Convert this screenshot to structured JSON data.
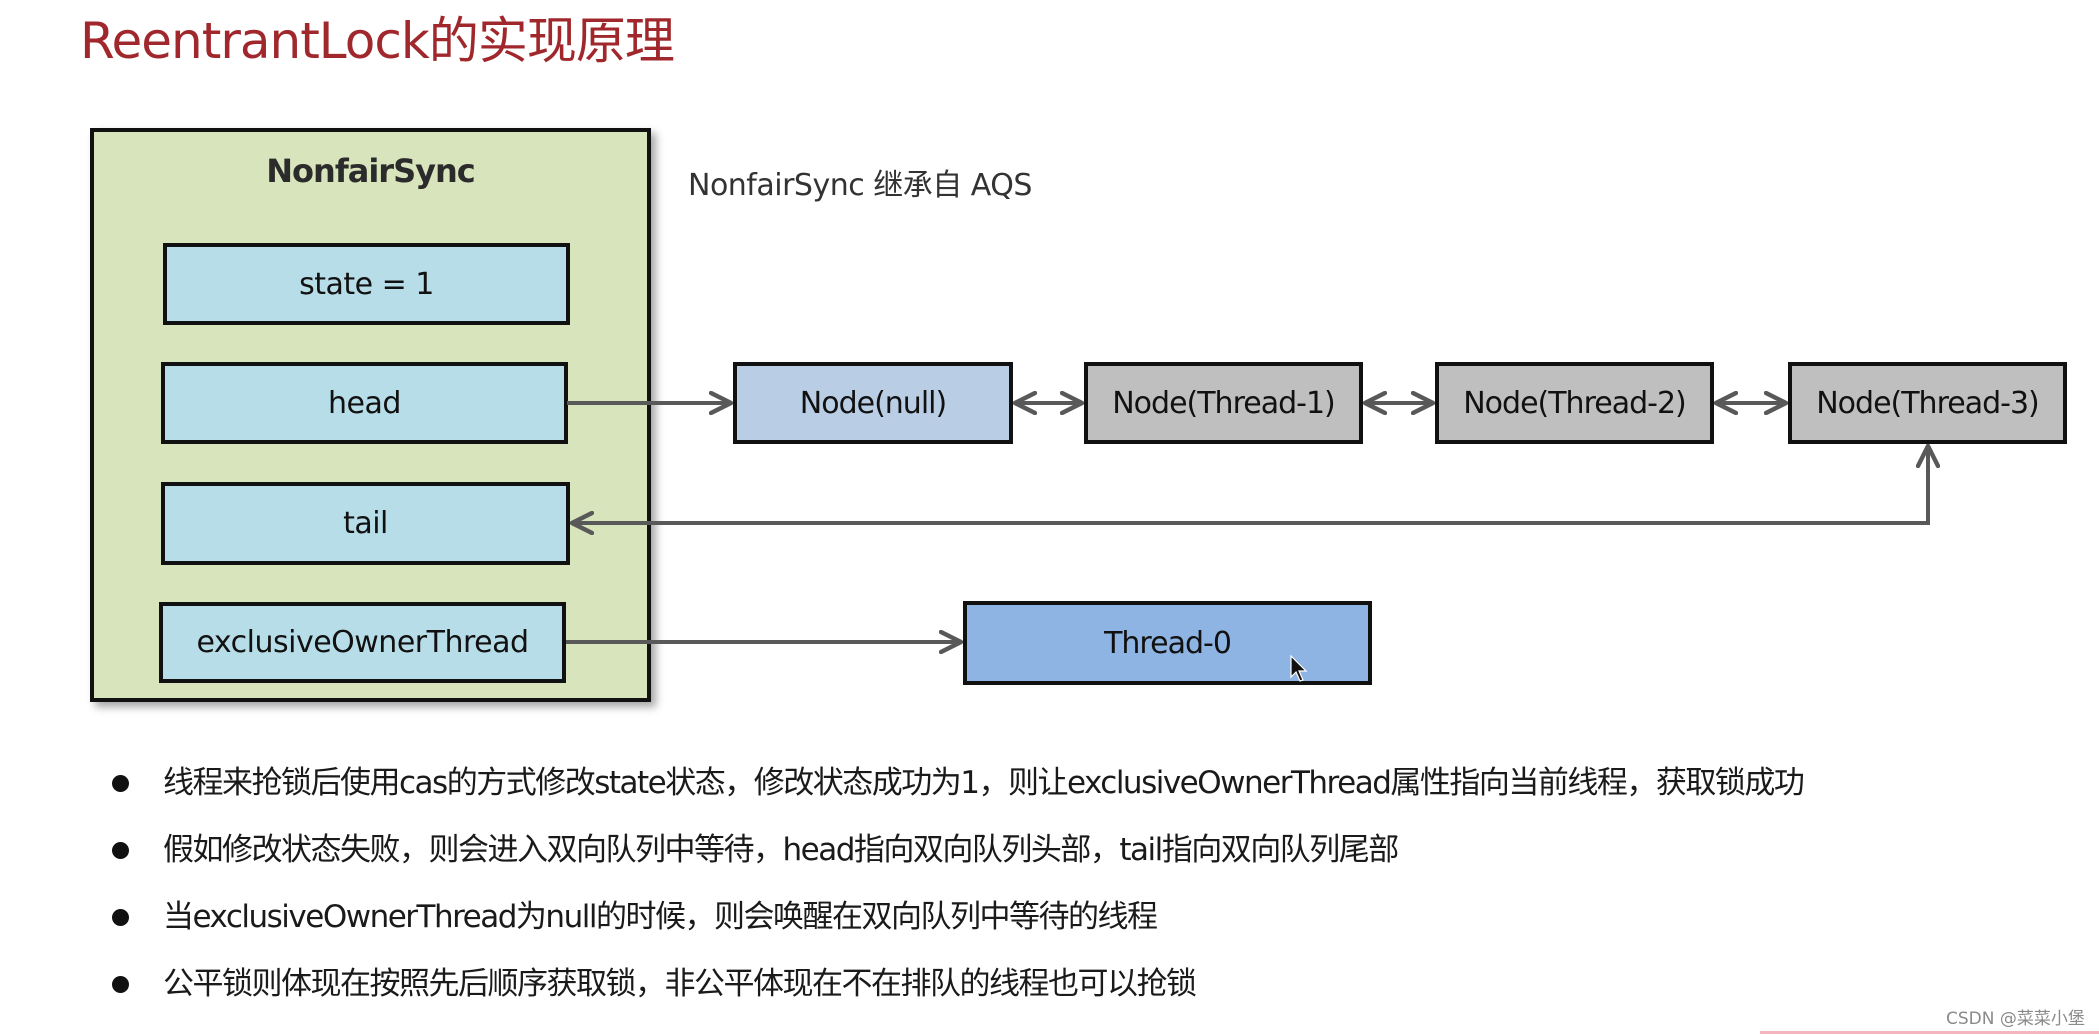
{
  "title": "ReentrantLock的实现原理",
  "diagram": {
    "container": {
      "label": "NonfairSync",
      "fill": "#d8e4bc",
      "fields": [
        {
          "label": "state = 1"
        },
        {
          "label": "head"
        },
        {
          "label": "tail"
        },
        {
          "label": "exclusiveOwnerThread"
        }
      ],
      "field_fill": "#b7dde8"
    },
    "note": "NonfairSync 继承自 AQS",
    "queue": [
      {
        "label": "Node(null)",
        "fill": "#b9cde5"
      },
      {
        "label": "Node(Thread-1)",
        "fill": "#bfbfbf"
      },
      {
        "label": "Node(Thread-2)",
        "fill": "#bfbfbf"
      },
      {
        "label": "Node(Thread-3)",
        "fill": "#bfbfbf"
      }
    ],
    "owner": {
      "label": "Thread-0",
      "fill": "#8eb4e3"
    },
    "edges": [
      {
        "from": "head",
        "to": "Node(null)",
        "type": "arrow"
      },
      {
        "from": "Node(null)",
        "to": "Node(Thread-1)",
        "type": "bidirectional"
      },
      {
        "from": "Node(Thread-1)",
        "to": "Node(Thread-2)",
        "type": "bidirectional"
      },
      {
        "from": "Node(Thread-2)",
        "to": "Node(Thread-3)",
        "type": "bidirectional"
      },
      {
        "from": "Node(Thread-3)",
        "to": "tail",
        "type": "bidirectional-elbow"
      },
      {
        "from": "exclusiveOwnerThread",
        "to": "Thread-0",
        "type": "arrow"
      }
    ],
    "edge_color": "#595959"
  },
  "bullets": [
    "线程来抢锁后使用cas的方式修改state状态，修改状态成功为1，则让exclusiveOwnerThread属性指向当前线程，获取锁成功",
    "假如修改状态失败，则会进入双向队列中等待，head指向双向队列头部，tail指向双向队列尾部",
    "当exclusiveOwnerThread为null的时候，则会唤醒在双向队列中等待的线程",
    "公平锁则体现在按照先后顺序获取锁，非公平体现在不在排队的线程也可以抢锁"
  ],
  "watermark": "CSDN @菜菜小堡",
  "colors": {
    "title": "#a0282d",
    "text": "#1a1a1a"
  }
}
